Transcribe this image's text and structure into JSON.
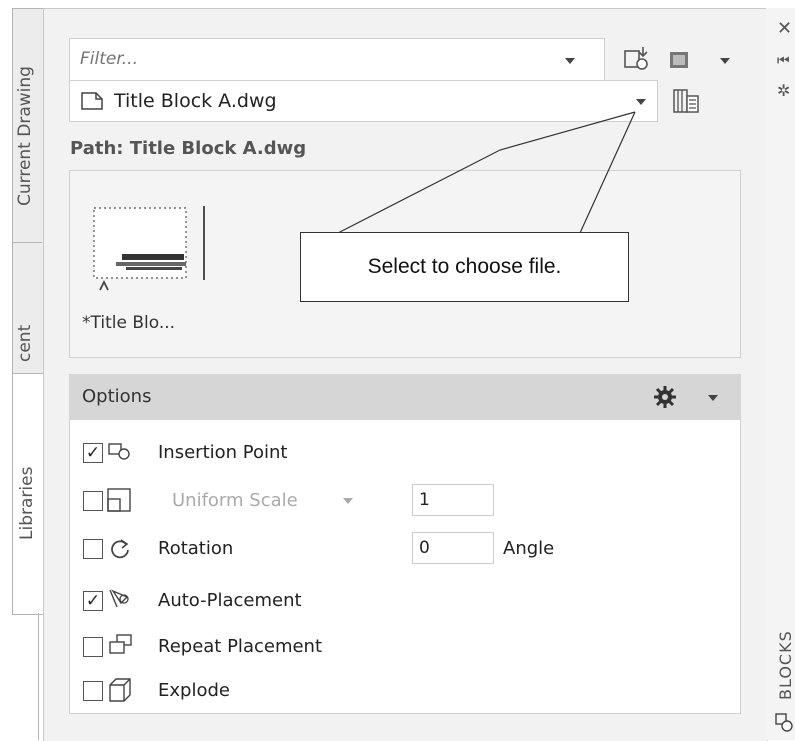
{
  "tabs": [
    {
      "label": "Current Drawing"
    },
    {
      "label": "cent"
    },
    {
      "label": "Libraries"
    }
  ],
  "filter": {
    "placeholder": "Filter..."
  },
  "file_select": {
    "value": "Title Block A.dwg"
  },
  "path": {
    "label": "Path: Title Block A.dwg"
  },
  "thumbnail": {
    "label": "*Title Blo..."
  },
  "callout": {
    "text": "Select to choose file."
  },
  "options": {
    "title": "Options",
    "rows": [
      {
        "label": "Insertion Point",
        "checked": true
      },
      {
        "label": "Uniform Scale",
        "checked": false,
        "value": "1"
      },
      {
        "label": "Rotation",
        "checked": false,
        "value": "0",
        "unit": "Angle"
      },
      {
        "label": "Auto-Placement",
        "checked": true
      },
      {
        "label": "Repeat Placement",
        "checked": false
      },
      {
        "label": "Explode",
        "checked": false
      }
    ]
  },
  "side_title": "BLOCKS",
  "colors": {
    "panel_bg": "#f2f2f2",
    "header_bg": "#d6d6d6",
    "tab_bg": "#ececec"
  }
}
